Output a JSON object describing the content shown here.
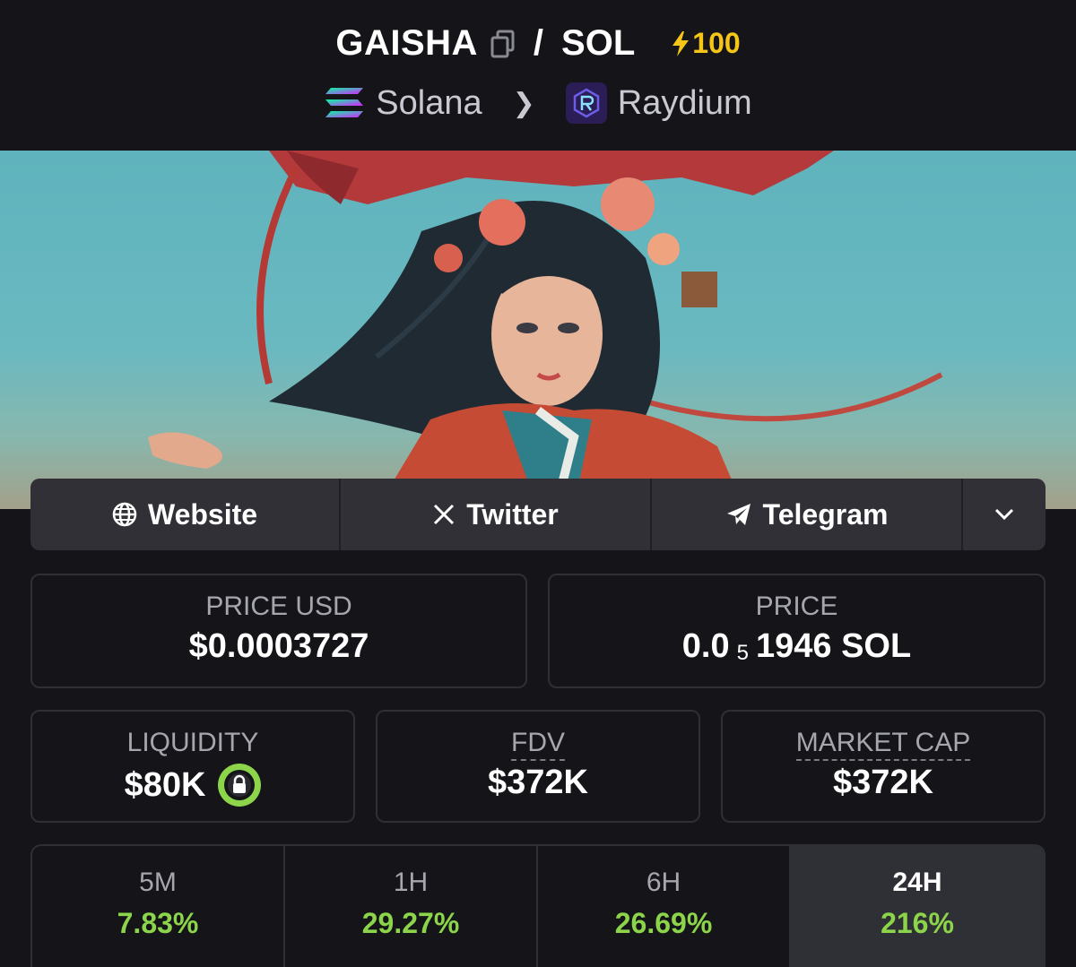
{
  "header": {
    "base_token": "GAISHA",
    "quote_token": "SOL",
    "boost": "100",
    "chain": "Solana",
    "dex": "Raydium"
  },
  "links": {
    "website": "Website",
    "twitter": "Twitter",
    "telegram": "Telegram"
  },
  "stats": {
    "price_usd_label": "PRICE USD",
    "price_usd": "$0.0003727",
    "price_label": "PRICE",
    "price_sol_prefix": "0.0",
    "price_sol_zeros": "5",
    "price_sol_rest": "1946 SOL",
    "liquidity_label": "LIQUIDITY",
    "liquidity": "$80K",
    "fdv_label": "FDV",
    "fdv": "$372K",
    "mcap_label": "MARKET CAP",
    "mcap": "$372K"
  },
  "timeframes": [
    {
      "label": "5M",
      "change": "7.83%"
    },
    {
      "label": "1H",
      "change": "29.27%"
    },
    {
      "label": "6H",
      "change": "26.69%"
    },
    {
      "label": "24H",
      "change": "216%"
    }
  ],
  "colors": {
    "background": "#141419",
    "positive": "#8cd44a",
    "boost": "#f5c518"
  },
  "icons": {
    "copy": "copy-icon",
    "boost": "lightning-icon",
    "chain": "solana-logo",
    "dex": "raydium-logo",
    "website": "globe-icon",
    "twitter": "x-logo-icon",
    "telegram": "telegram-icon",
    "more": "chevron-down-icon",
    "liquidity": "lock-icon"
  }
}
